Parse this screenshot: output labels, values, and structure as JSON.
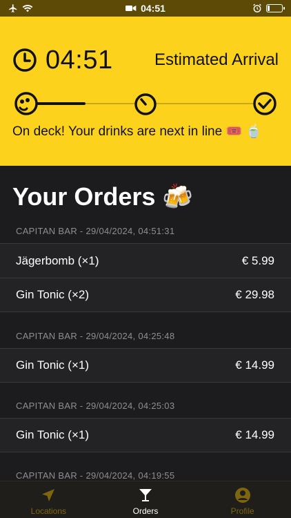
{
  "status_bar": {
    "time": "04:51"
  },
  "header": {
    "time": "04:51",
    "eta_label": "Estimated Arrival",
    "message": "On deck! Your drinks are next in line 🎟️ 🍵"
  },
  "orders_title": "Your Orders 🍻",
  "order_groups": [
    {
      "header": "CAPITAN BAR - 29/04/2024, 04:51:31",
      "items": [
        {
          "name": "Jägerbomb (×1)",
          "price": "€ 5.99"
        },
        {
          "name": "Gin Tonic (×2)",
          "price": "€ 29.98"
        }
      ]
    },
    {
      "header": "CAPITAN BAR - 29/04/2024, 04:25:48",
      "items": [
        {
          "name": "Gin Tonic (×1)",
          "price": "€ 14.99"
        }
      ]
    },
    {
      "header": "CAPITAN BAR - 29/04/2024, 04:25:03",
      "items": [
        {
          "name": "Gin Tonic (×1)",
          "price": "€ 14.99"
        }
      ]
    },
    {
      "header": "CAPITAN BAR - 29/04/2024, 04:19:55",
      "items": []
    }
  ],
  "tabs": [
    {
      "label": "Locations",
      "icon": "location-arrow-icon",
      "active": false
    },
    {
      "label": "Orders",
      "icon": "cocktail-icon",
      "active": true
    },
    {
      "label": "Profile",
      "icon": "person-icon",
      "active": false
    }
  ],
  "colors": {
    "accent": "#fdd21c",
    "background": "#1c1c1e",
    "row": "#232325",
    "muted": "#8e8e93",
    "tab_inactive": "#7d6610"
  }
}
